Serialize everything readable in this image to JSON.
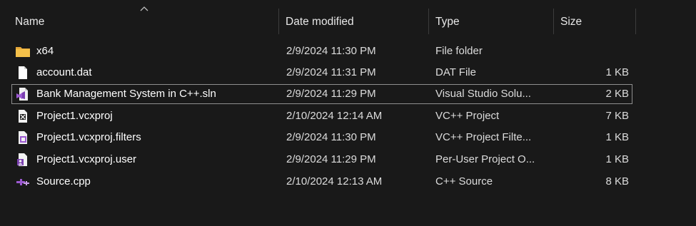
{
  "columns": {
    "name": "Name",
    "date": "Date modified",
    "type": "Type",
    "size": "Size"
  },
  "files": [
    {
      "name": "x64",
      "date": "2/9/2024 11:30 PM",
      "type": "File folder",
      "size": "",
      "icon": "folder-icon"
    },
    {
      "name": "account.dat",
      "date": "2/9/2024 11:31 PM",
      "type": "DAT File",
      "size": "1 KB",
      "icon": "file-icon"
    },
    {
      "name": "Bank Management System in C++.sln",
      "date": "2/9/2024 11:29 PM",
      "type": "Visual Studio Solu...",
      "size": "2 KB",
      "icon": "visual-studio-solution-icon"
    },
    {
      "name": "Project1.vcxproj",
      "date": "2/10/2024 12:14 AM",
      "type": "VC++ Project",
      "size": "7 KB",
      "icon": "vcxproj-icon"
    },
    {
      "name": "Project1.vcxproj.filters",
      "date": "2/9/2024 11:30 PM",
      "type": "VC++ Project Filte...",
      "size": "1 KB",
      "icon": "vcxproj-filters-icon"
    },
    {
      "name": "Project1.vcxproj.user",
      "date": "2/9/2024 11:29 PM",
      "type": "Per-User Project O...",
      "size": "1 KB",
      "icon": "vcxproj-user-icon"
    },
    {
      "name": "Source.cpp",
      "date": "2/10/2024 12:13 AM",
      "type": "C++ Source",
      "size": "8 KB",
      "icon": "cpp-source-icon"
    }
  ],
  "colors": {
    "background": "#191919",
    "folder": "#f4c04a",
    "vs_purple": "#9b59d0"
  }
}
